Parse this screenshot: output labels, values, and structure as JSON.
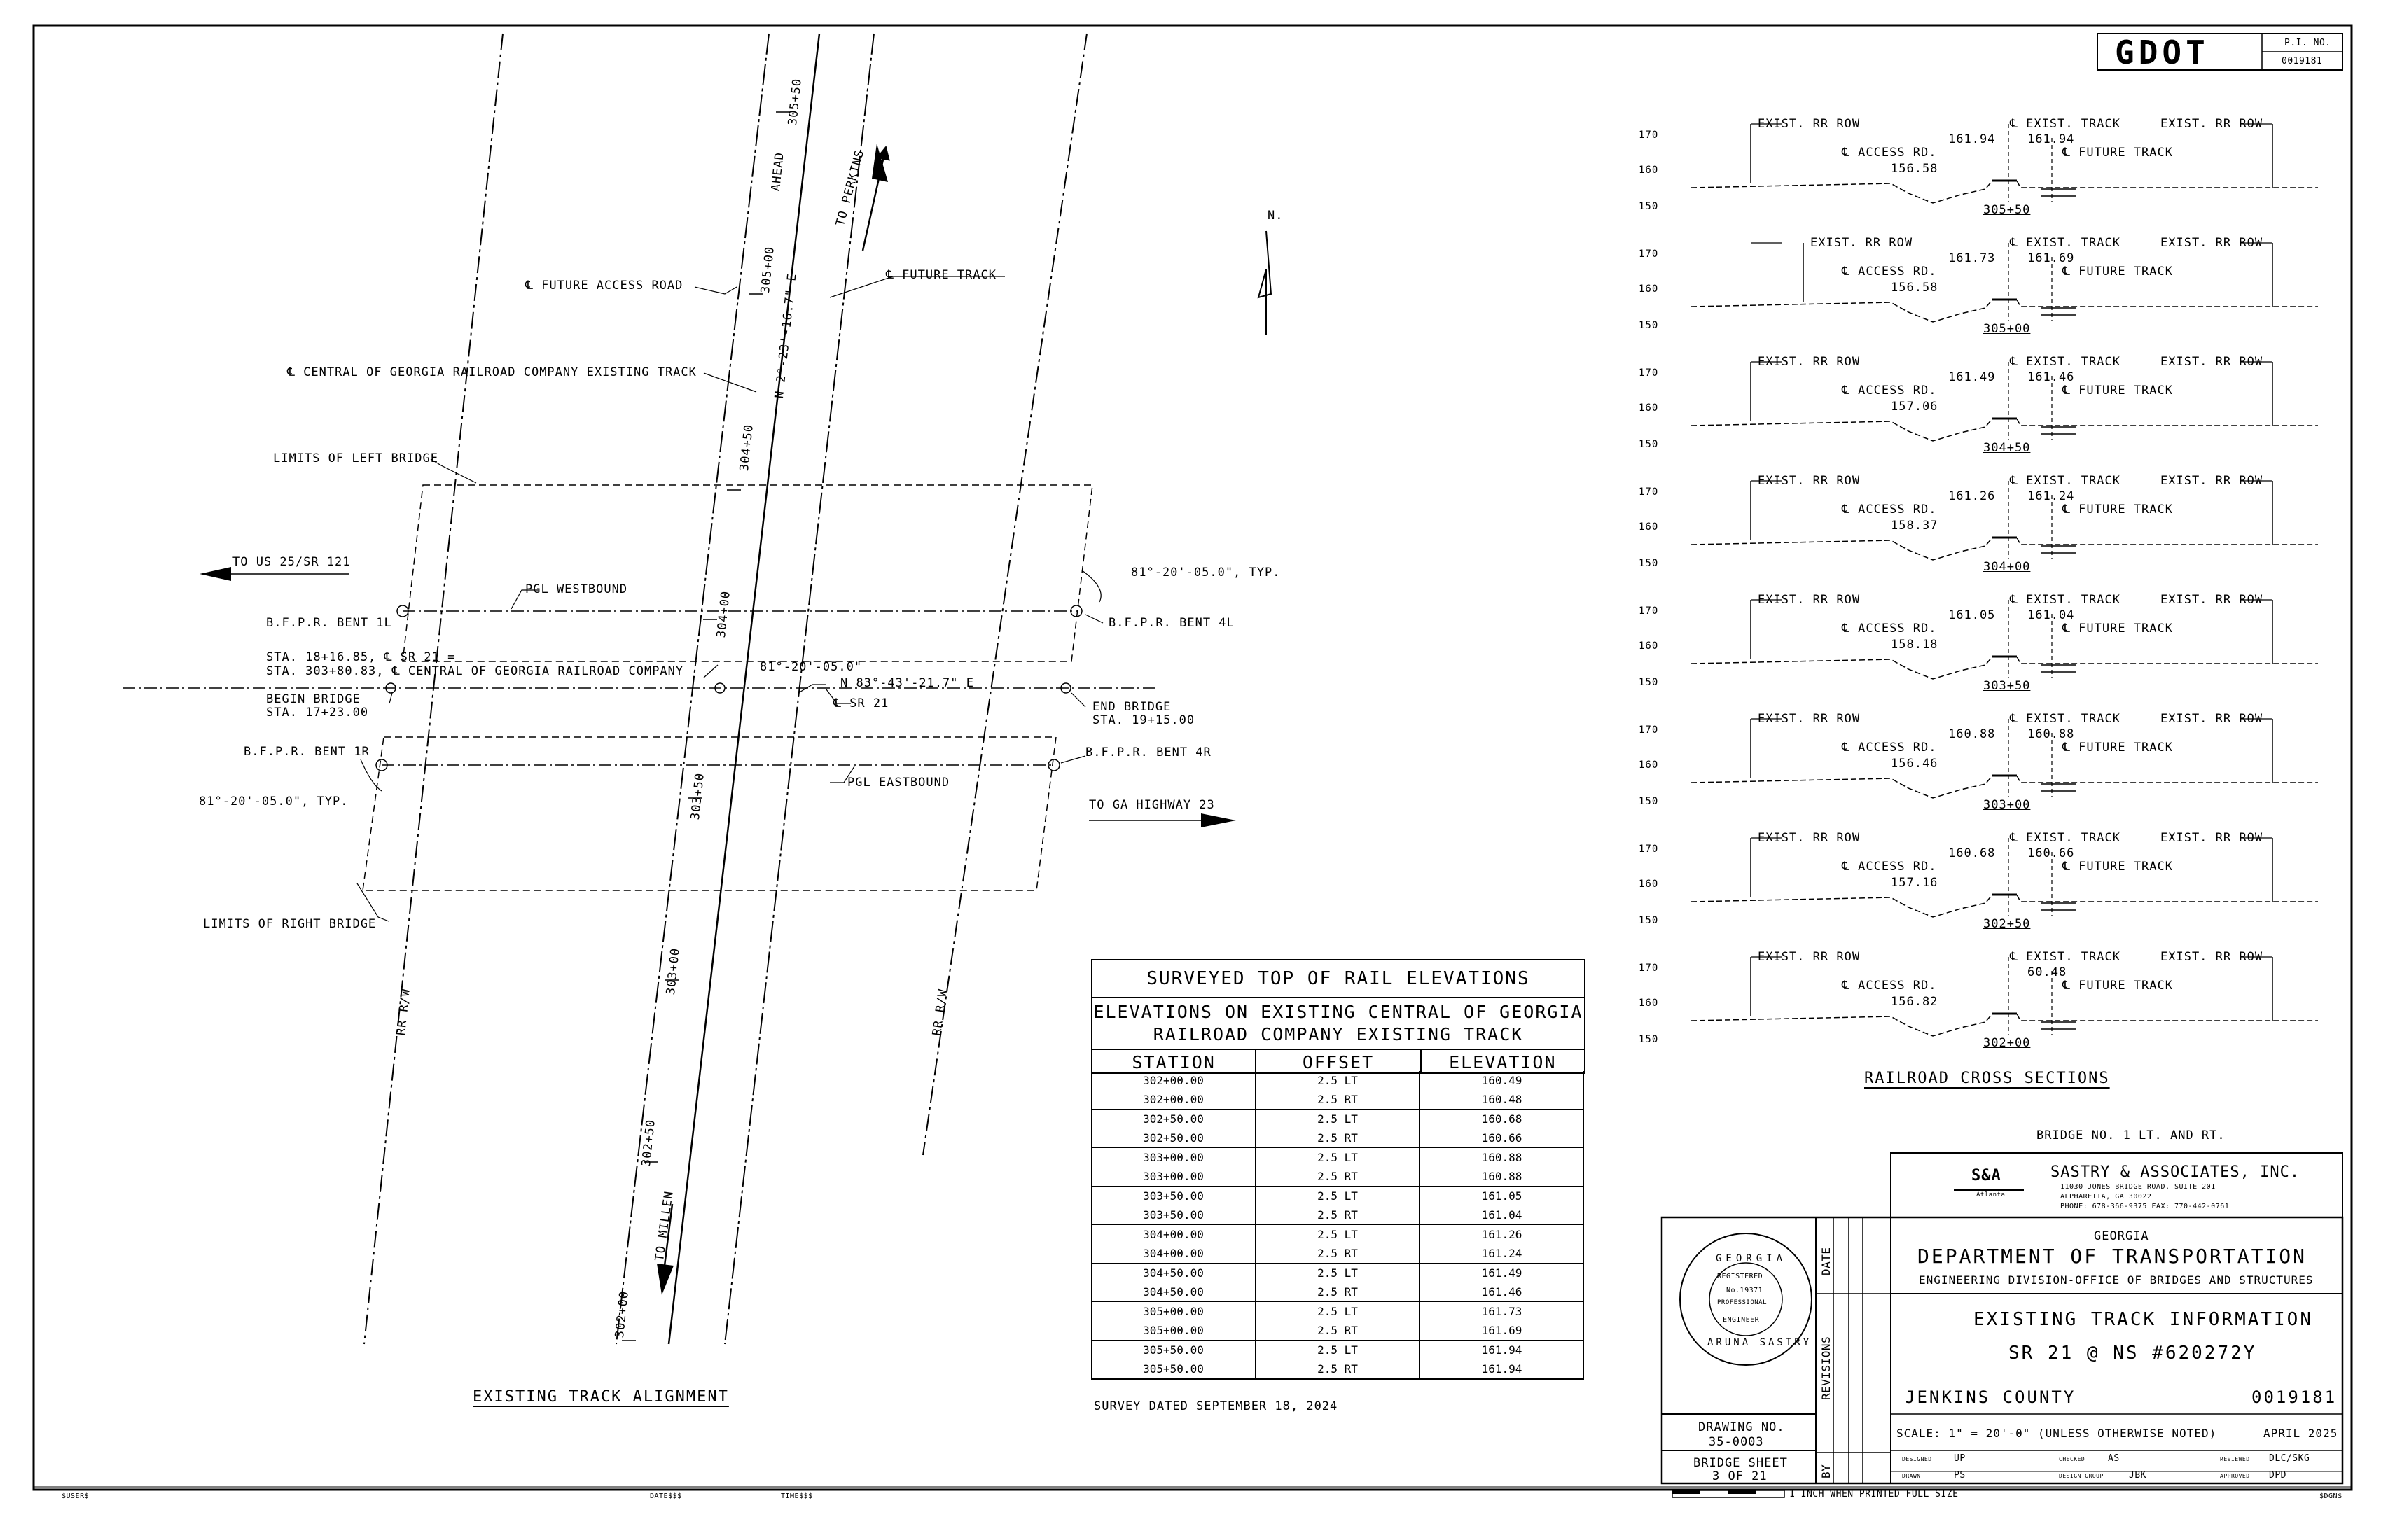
{
  "plan": {
    "title": "EXISTING TRACK ALIGNMENT",
    "north": "N.",
    "labels": {
      "future_access_road": "℄ FUTURE ACCESS ROAD",
      "future_track": "℄ FUTURE TRACK",
      "central_georgia": "℄ CENTRAL OF GEORGIA RAILROAD COMPANY EXISTING TRACK",
      "limits_left": "LIMITS OF LEFT BRIDGE",
      "limits_right": "LIMITS OF RIGHT BRIDGE",
      "to_us25": "TO US 25/SR 121",
      "to_ga23": "TO GA HIGHWAY 23",
      "to_perkins": "TO PERKINS",
      "to_millen": "TO MILLEN",
      "ahead": "AHEAD",
      "pgl_west": "PGL WESTBOUND",
      "pgl_east": "PGL EASTBOUND",
      "bent_1l": "B.F.P.R. BENT 1L",
      "bent_4l": "B.F.P.R. BENT 4L",
      "bent_1r": "B.F.P.R. BENT 1R",
      "bent_4r": "B.F.P.R. BENT 4R",
      "angle_typ_right": "81°-20'-05.0\", TYP.",
      "angle_typ_left": "81°-20'-05.0\", TYP.",
      "angle_center": "81°-20'-05.0\"",
      "sta_line1": "STA. 18+16.85, ℄ SR 21 =",
      "sta_line2": "STA. 303+80.83, ℄ CENTRAL OF GEORGIA RAILROAD COMPANY",
      "begin_bridge_1": "BEGIN BRIDGE",
      "begin_bridge_2": "STA. 17+23.00",
      "end_bridge_1": "END BRIDGE",
      "end_bridge_2": "STA. 19+15.00",
      "sr21": "℄ SR 21",
      "bearing_track": "N 2°-23'-16.7\" E",
      "bearing_sr21": "N 83°-43'-21.7\" E",
      "rr_rw": "RR R/W",
      "st_30550": "305+50",
      "st_30500": "305+00",
      "st_30450": "304+50",
      "st_30400": "304+00",
      "st_30350": "303+50",
      "st_30300": "303+00",
      "st_30250": "302+50",
      "st_30200": "302+00"
    }
  },
  "elevations": {
    "title": "SURVEYED TOP OF RAIL ELEVATIONS",
    "subtitle_1": "ELEVATIONS ON EXISTING CENTRAL OF GEORGIA",
    "subtitle_2": "RAILROAD COMPANY EXISTING TRACK",
    "columns": [
      "STATION",
      "OFFSET",
      "ELEVATION"
    ],
    "rows": [
      [
        "302+00.00",
        "2.5 LT",
        "160.49"
      ],
      [
        "302+00.00",
        "2.5 RT",
        "160.48"
      ],
      [
        "302+50.00",
        "2.5 LT",
        "160.68"
      ],
      [
        "302+50.00",
        "2.5 RT",
        "160.66"
      ],
      [
        "303+00.00",
        "2.5 LT",
        "160.88"
      ],
      [
        "303+00.00",
        "2.5 RT",
        "160.88"
      ],
      [
        "303+50.00",
        "2.5 LT",
        "161.05"
      ],
      [
        "303+50.00",
        "2.5 RT",
        "161.04"
      ],
      [
        "304+00.00",
        "2.5 LT",
        "161.26"
      ],
      [
        "304+00.00",
        "2.5 RT",
        "161.24"
      ],
      [
        "304+50.00",
        "2.5 LT",
        "161.49"
      ],
      [
        "304+50.00",
        "2.5 RT",
        "161.46"
      ],
      [
        "305+00.00",
        "2.5 LT",
        "161.73"
      ],
      [
        "305+00.00",
        "2.5 RT",
        "161.69"
      ],
      [
        "305+50.00",
        "2.5 LT",
        "161.94"
      ],
      [
        "305+50.00",
        "2.5 RT",
        "161.94"
      ]
    ],
    "survey_note": "SURVEY DATED SEPTEMBER 18, 2024"
  },
  "cross_sections": {
    "title": "RAILROAD CROSS SECTIONS",
    "labels": {
      "exist_row": "EXIST. RR ROW",
      "exist_track": "℄ EXIST. TRACK",
      "access_rd": "℄ ACCESS RD.",
      "future_track": "℄ FUTURE TRACK"
    },
    "elev_ticks": [
      "170",
      "160",
      "150"
    ],
    "sections": [
      {
        "station": "305+50",
        "road": "156.58",
        "lt": "161.94",
        "rt": "161.94"
      },
      {
        "station": "305+00",
        "road": "156.58",
        "lt": "161.73",
        "rt": "161.69"
      },
      {
        "station": "304+50",
        "road": "157.06",
        "lt": "161.49",
        "rt": "161.46"
      },
      {
        "station": "304+00",
        "road": "158.37",
        "lt": "161.26",
        "rt": "161.24"
      },
      {
        "station": "303+50",
        "road": "158.18",
        "lt": "161.05",
        "rt": "161.04"
      },
      {
        "station": "303+00",
        "road": "156.46",
        "lt": "160.88",
        "rt": "160.88"
      },
      {
        "station": "302+50",
        "road": "157.16",
        "lt": "160.68",
        "rt": "160.66"
      },
      {
        "station": "302+00",
        "road": "156.82",
        "lt": "",
        "rt": "60.48"
      }
    ]
  },
  "title_block": {
    "logo": "GDOT",
    "pi_label": "P.I. NO.",
    "pi_number": "0019181",
    "bridge_note": "BRIDGE NO. 1 LT. AND RT.",
    "consultant": "SASTRY & ASSOCIATES, INC.",
    "consultant_logo": "S&A",
    "consultant_logo_city": "Atlanta",
    "consultant_addr1": "11030 JONES BRIDGE ROAD, SUITE 201",
    "consultant_addr2": "ALPHARETTA, GA 30022",
    "consultant_phone": "PHONE: 678-366-9375      FAX: 770-442-0761",
    "state": "GEORGIA",
    "dept": "DEPARTMENT OF TRANSPORTATION",
    "division": "ENGINEERING DIVISION-OFFICE OF BRIDGES AND STRUCTURES",
    "sheet_title": "EXISTING TRACK INFORMATION",
    "sheet_subtitle": "SR 21 @ NS #620272Y",
    "county": "JENKINS COUNTY",
    "project_no": "0019181",
    "scale": "SCALE: 1\" = 20'-0\" (UNLESS OTHERWISE NOTED)",
    "date_issued": "APRIL 2025",
    "drawing_no_label": "DRAWING NO.",
    "drawing_no": "35-0003",
    "bridge_sheet_label": "BRIDGE SHEET",
    "bridge_sheet": "3 OF 21",
    "col_date": "DATE",
    "col_revisions": "REVISIONS",
    "col_by": "BY",
    "designed_label": "DESIGNED",
    "designed": "UP",
    "checked_label": "CHECKED",
    "checked": "AS",
    "reviewed_label": "REVIEWED",
    "reviewed": "DLC/SKG",
    "drawn_label": "DRAWN",
    "drawn": "PS",
    "design_group_label": "DESIGN GROUP",
    "design_group": "JBK",
    "approved_label": "APPROVED",
    "approved": "DPD",
    "scale_bar_note": "1 INCH WHEN PRINTED FULL SIZE",
    "seal_state": "GEORGIA",
    "seal_registered": "REGISTERED",
    "seal_no": "No.19371",
    "seal_professional": "PROFESSIONAL",
    "seal_engineer": "ENGINEER",
    "seal_name": "ARUNA SASTRY",
    "footer_user": "$USER$",
    "footer_date": "DATE$$$",
    "footer_time": "TIME$$$",
    "footer_file": "$DGN$"
  }
}
